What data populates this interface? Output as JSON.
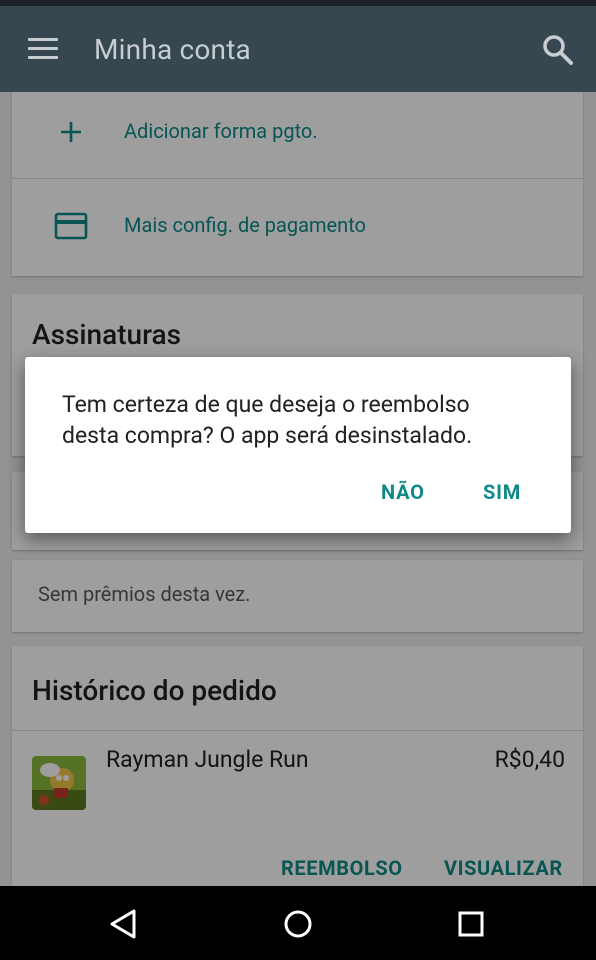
{
  "appbar": {
    "title": "Minha conta"
  },
  "payment": {
    "add_label": "Adicionar forma pgto.",
    "config_label": "Mais config. de pagamento"
  },
  "subscriptions": {
    "title": "Assinaturas"
  },
  "rewards": {
    "empty_text": "Sem prêmios desta vez."
  },
  "order_history": {
    "title": "Histórico do pedido",
    "items": [
      {
        "name": "Rayman Jungle Run",
        "price": "R$0,40",
        "refund_label": "REEMBOLSO",
        "view_label": "VISUALIZAR"
      }
    ]
  },
  "dialog": {
    "message": "Tem certeza de que deseja o reembolso desta compra? O app será desinstalado.",
    "no_label": "NÃO",
    "yes_label": "SIM"
  },
  "colors": {
    "appbar": "#37474f",
    "accent": "#0e8a88"
  },
  "icons": [
    "menu-icon",
    "search-icon",
    "add-icon",
    "credit-card-icon",
    "back-icon",
    "home-icon",
    "recents-icon"
  ]
}
